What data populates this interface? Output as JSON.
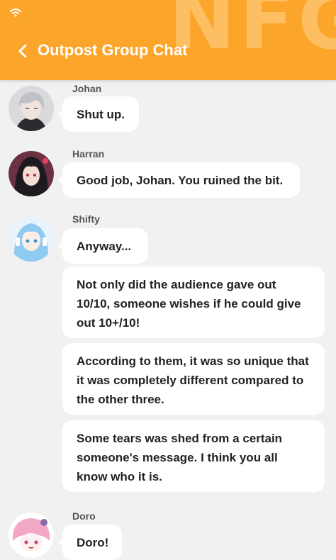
{
  "header": {
    "title": "Outpost Group Chat",
    "watermark": "NFG",
    "accent_color": "#fba52a",
    "back_icon": "chevron-left-icon",
    "status_icon": "wifi-icon"
  },
  "messages": [
    {
      "sender": "Johan",
      "text": "Shut up.",
      "avatar": "johan-avatar"
    },
    {
      "sender": "Harran",
      "text": "Good job, Johan. You ruined the bit.",
      "avatar": "harran-avatar"
    },
    {
      "sender": "Shifty",
      "text": "Anyway...",
      "avatar": "shifty-avatar"
    },
    {
      "sender": "Shifty",
      "text": "Not only did the audience gave out 10/10, someone wishes if he could give out 10+/10!"
    },
    {
      "sender": "Shifty",
      "text": "According to them, it was so unique that it was completely different compared to the other three."
    },
    {
      "sender": "Shifty",
      "text": "Some tears was shed from a certain someone's message. I think you all know who it is."
    },
    {
      "sender": "Doro",
      "text": "Doro!",
      "avatar": "doro-avatar"
    }
  ]
}
